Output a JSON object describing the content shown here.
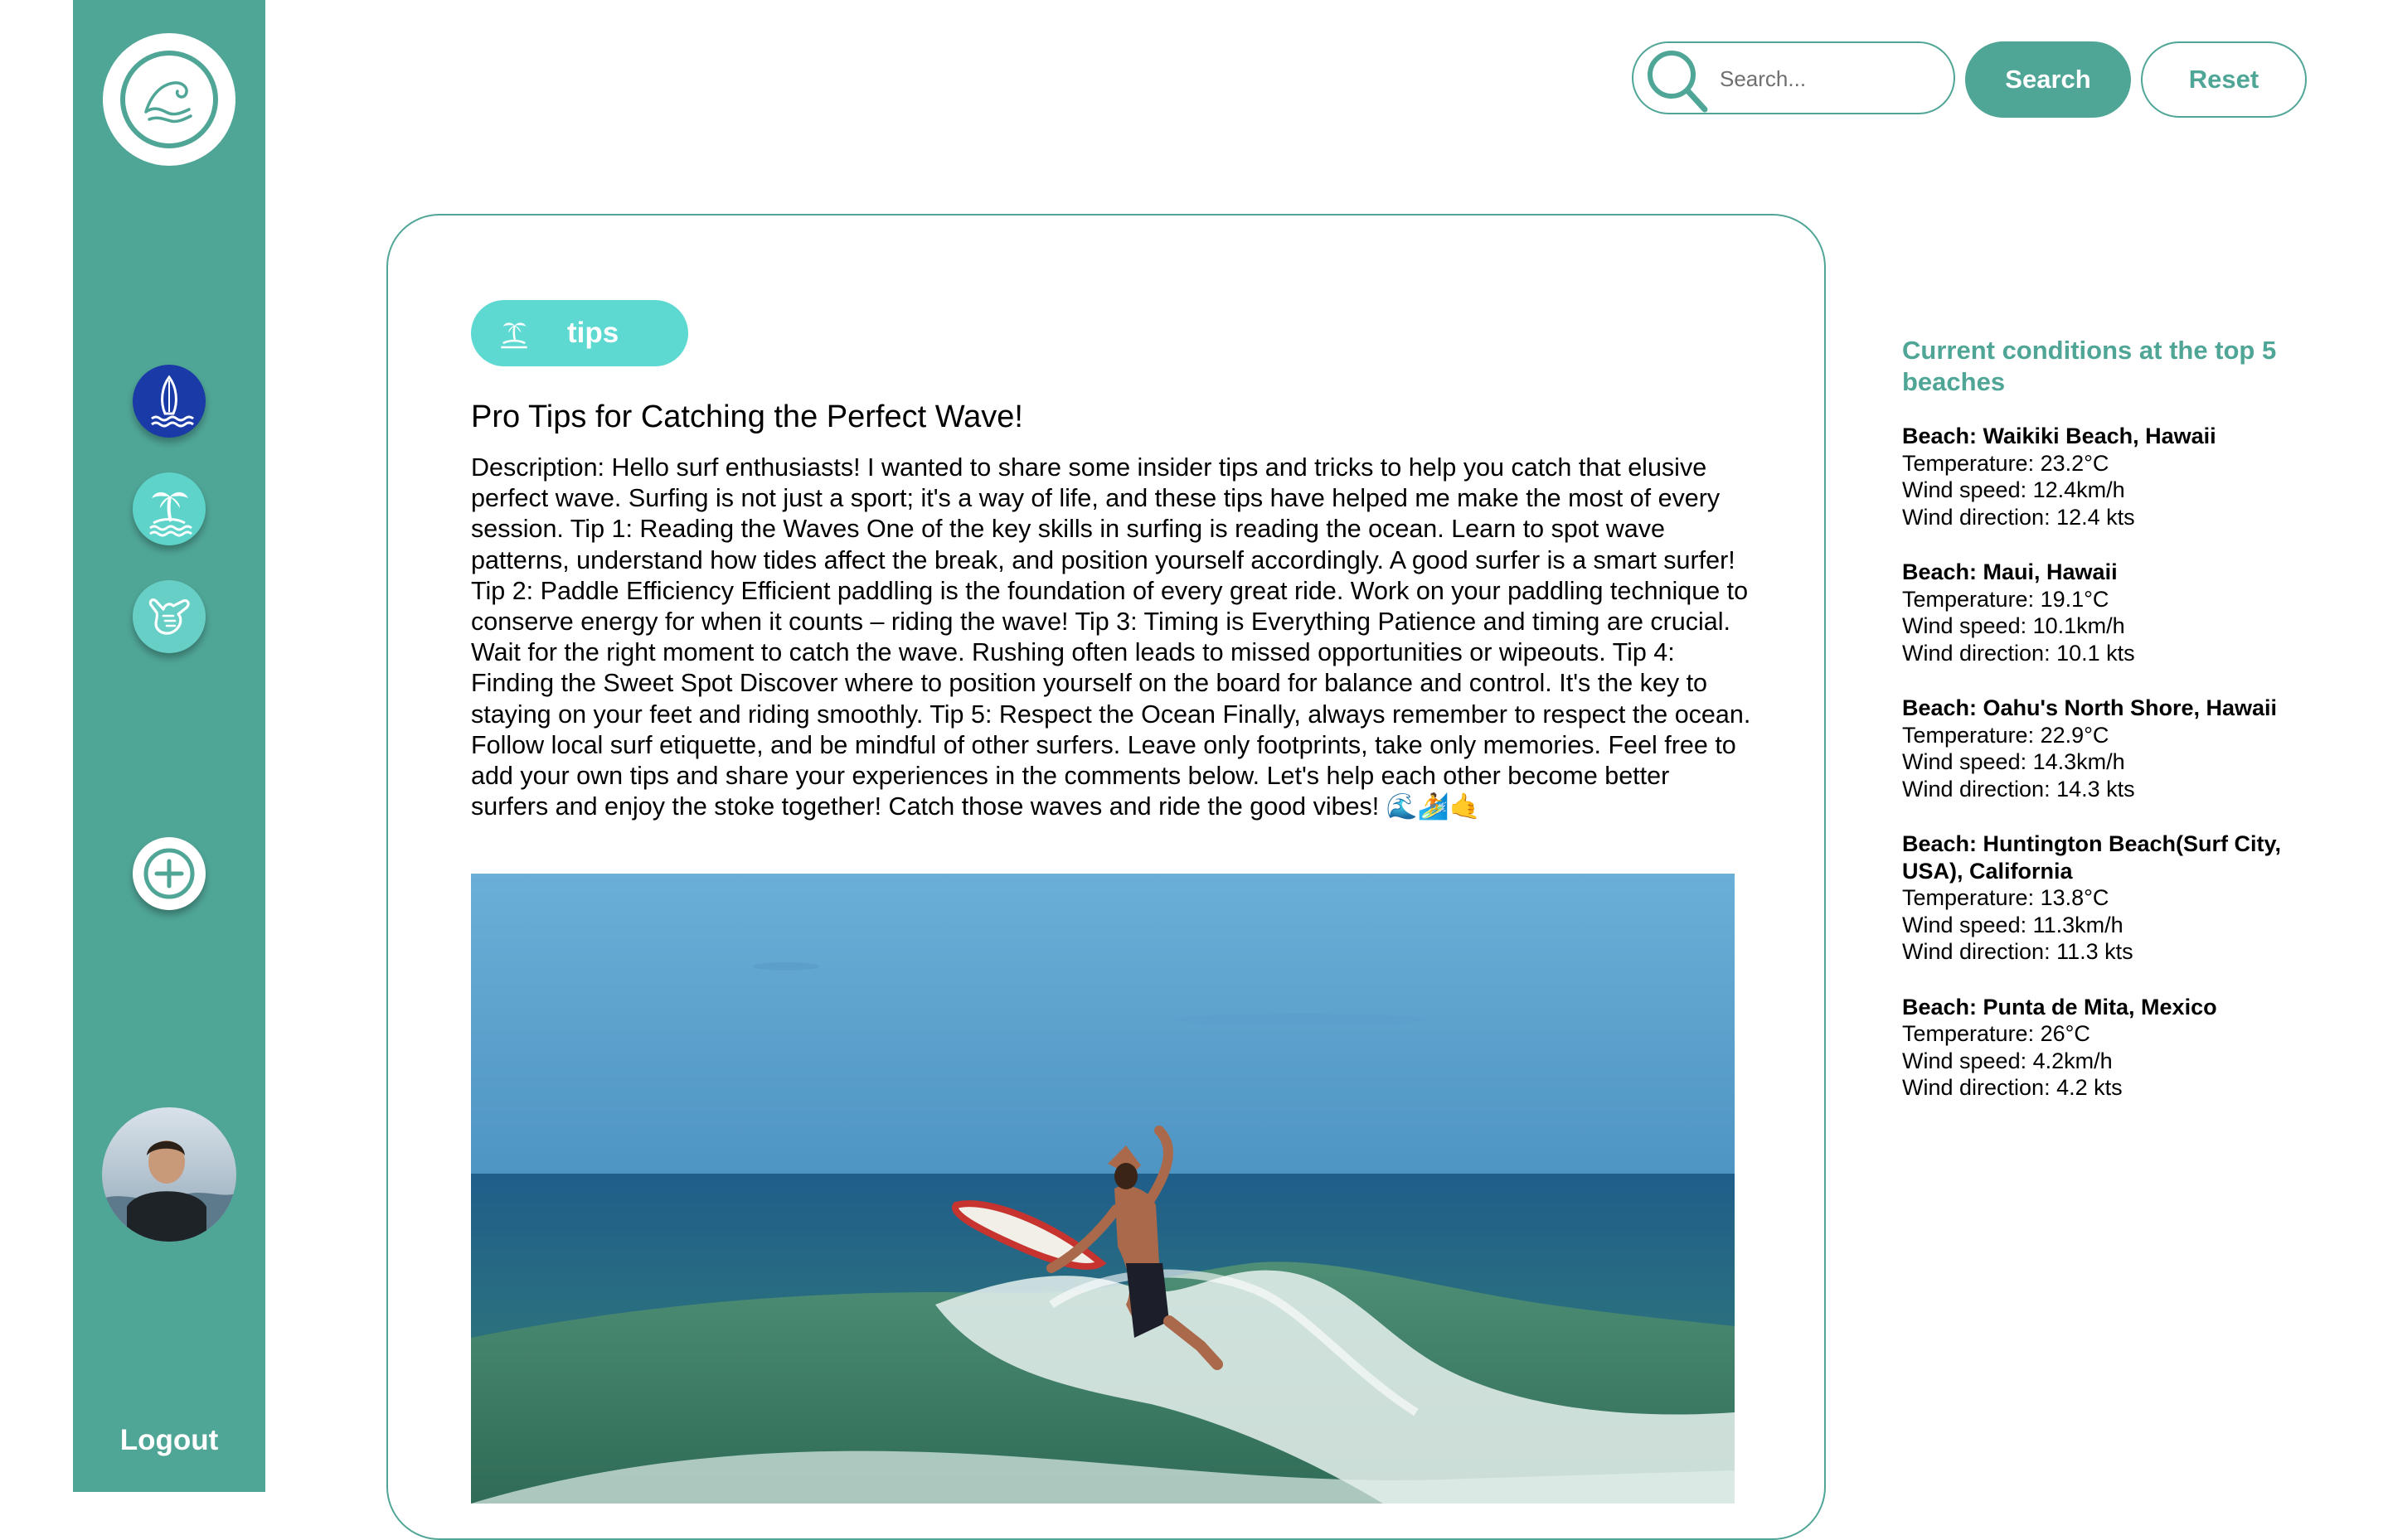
{
  "sidebar": {
    "logo": "wave-logo",
    "nav": [
      {
        "icon": "surfboard-icon"
      },
      {
        "icon": "palm-island-icon"
      },
      {
        "icon": "shaka-hand-icon"
      }
    ],
    "add_icon": "plus-icon",
    "logout_label": "Logout"
  },
  "search": {
    "placeholder": "Search...",
    "value": "",
    "search_label": "Search",
    "reset_label": "Reset"
  },
  "post": {
    "tag": "tips",
    "tag_icon": "palm-island-icon",
    "title": "Pro Tips for Catching the Perfect Wave!",
    "body": "Description: Hello surf enthusiasts! I wanted to share some insider tips and tricks to help you catch that elusive perfect wave. Surfing is not just a sport; it's a way of life, and these tips have helped me make the most of every session. Tip 1: Reading the Waves One of the key skills in surfing is reading the ocean. Learn to spot wave patterns, understand how tides affect the break, and position yourself accordingly. A good surfer is a smart surfer! Tip 2: Paddle Efficiency Efficient paddling is the foundation of every great ride. Work on your paddling technique to conserve energy for when it counts – riding the wave!  Tip 3: Timing is Everything Patience and timing are crucial. Wait for the right moment to catch the wave. Rushing often leads to missed opportunities or wipeouts.  Tip 4: Finding the Sweet Spot Discover where to position yourself on the board for balance and control. It's the key to staying on your feet and riding smoothly.  Tip 5: Respect the Ocean Finally, always remember to respect the ocean. Follow local surf etiquette, and be mindful of other surfers. Leave only footprints, take only memories. Feel free to add your own tips and share your experiences in the comments below. Let's help each other become better surfers and enjoy the stoke together! Catch those waves and ride the good vibes! 🌊🏄🤙"
  },
  "conditions": {
    "title": "Current conditions at the top 5 beaches",
    "beaches": [
      {
        "name": "Beach: Waikiki Beach, Hawaii",
        "temperature": "Temperature: 23.2°C",
        "wind_speed": "Wind speed: 12.4km/h",
        "wind_direction": "Wind direction: 12.4 kts"
      },
      {
        "name": "Beach: Maui, Hawaii",
        "temperature": "Temperature: 19.1°C",
        "wind_speed": "Wind speed: 10.1km/h",
        "wind_direction": "Wind direction: 10.1 kts"
      },
      {
        "name": "Beach: Oahu's North Shore, Hawaii",
        "temperature": "Temperature: 22.9°C",
        "wind_speed": "Wind speed: 14.3km/h",
        "wind_direction": "Wind direction: 14.3 kts"
      },
      {
        "name": "Beach: Huntington Beach(Surf City, USA), California",
        "temperature": "Temperature: 13.8°C",
        "wind_speed": "Wind speed: 11.3km/h",
        "wind_direction": "Wind direction: 11.3 kts"
      },
      {
        "name": "Beach: Punta de Mita, Mexico",
        "temperature": "Temperature: 26°C",
        "wind_speed": "Wind speed: 4.2km/h",
        "wind_direction": "Wind direction: 4.2 kts"
      }
    ]
  },
  "colors": {
    "brand": "#4fa596",
    "tag_bg": "#5ed9d2",
    "surf_nav": "#1a3aa8"
  }
}
